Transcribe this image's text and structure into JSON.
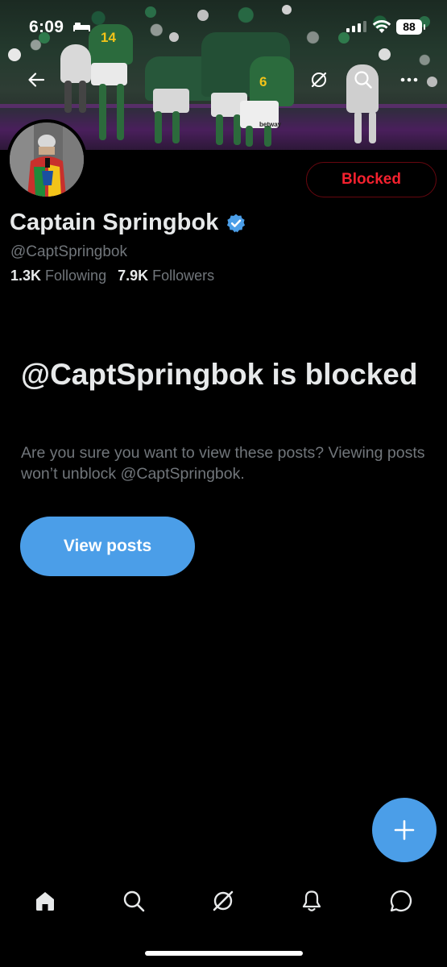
{
  "status_bar": {
    "time": "6:09",
    "battery": "88"
  },
  "banner": {
    "jersey_numbers": [
      "14",
      "6"
    ],
    "sponsor_text": "betway"
  },
  "profile": {
    "display_name": "Captain Springbok",
    "handle": "@CaptSpringbok",
    "following_count": "1.3K",
    "following_label": "Following",
    "followers_count": "7.9K",
    "followers_label": "Followers",
    "blocked_button_label": "Blocked",
    "verified": true
  },
  "blocked_notice": {
    "title": "@CaptSpringbok is blocked",
    "description": "Are you sure you want to view these posts? Viewing posts won’t unblock @CaptSpringbok.",
    "view_button_label": "View posts"
  },
  "nav": {
    "icons": [
      "back-arrow-icon",
      "grok-icon",
      "search-icon",
      "more-icon"
    ]
  },
  "tabbar": {
    "tabs": [
      "home-icon",
      "search-icon",
      "grok-icon",
      "notifications-bell-icon",
      "messages-icon"
    ]
  },
  "colors": {
    "accent": "#4b9ee8",
    "blocked_red": "#f4212e",
    "secondary_text": "#71767b",
    "primary_text": "#e7e9ea",
    "background": "#000000"
  }
}
